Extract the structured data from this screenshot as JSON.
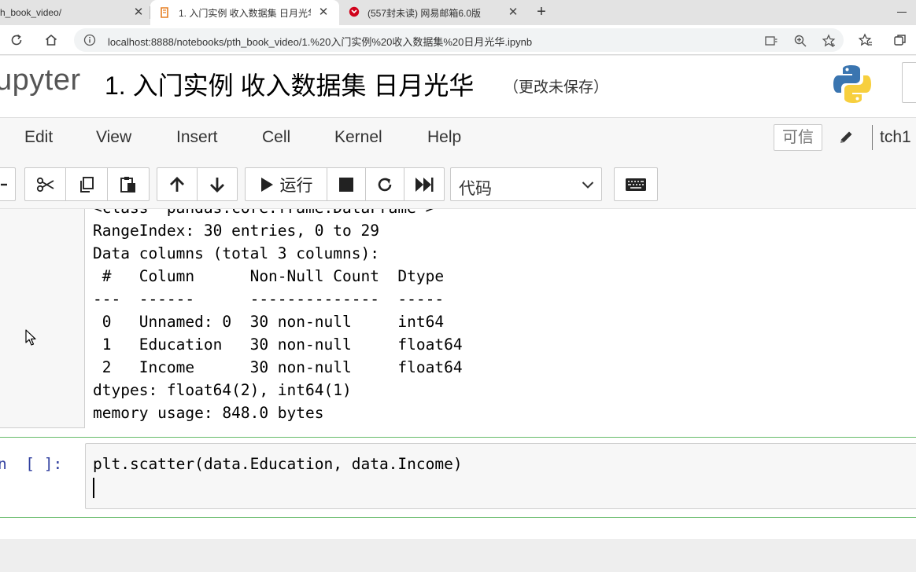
{
  "browser": {
    "tabs": [
      {
        "title": "h_book_video/"
      },
      {
        "title": "1. 入门实例 收入数据集 日月光华"
      },
      {
        "title": "(557封未读) 网易邮箱6.0版"
      }
    ],
    "url": "localhost:8888/notebooks/pth_book_video/1.%20入门实例%20收入数据集%20日月光华.ipynb"
  },
  "header": {
    "logo_text": "upyter",
    "notebook_title": "1. 入门实例 收入数据集 日月光华",
    "save_status": "（更改未保存）"
  },
  "menu": {
    "items": [
      "Edit",
      "View",
      "Insert",
      "Cell",
      "Kernel",
      "Help"
    ],
    "trusted": "可信",
    "kernel": "tch1"
  },
  "toolbar": {
    "run_label": "运行",
    "cell_type": "代码"
  },
  "output_cell": {
    "partial_first_line": "<class 'pandas.core.frame.DataFrame'>",
    "lines": [
      "RangeIndex: 30 entries, 0 to 29",
      "Data columns (total 3 columns):",
      " #   Column      Non-Null Count  Dtype  ",
      "---  ------      --------------  -----  ",
      " 0   Unnamed: 0  30 non-null     int64  ",
      " 1   Education   30 non-null     float64",
      " 2   Income      30 non-null     float64",
      "dtypes: float64(2), int64(1)",
      "memory usage: 848.0 bytes"
    ]
  },
  "input_cell": {
    "prompt": "n  [ ]:",
    "code": "plt.scatter(data.Education, data.Income)"
  }
}
